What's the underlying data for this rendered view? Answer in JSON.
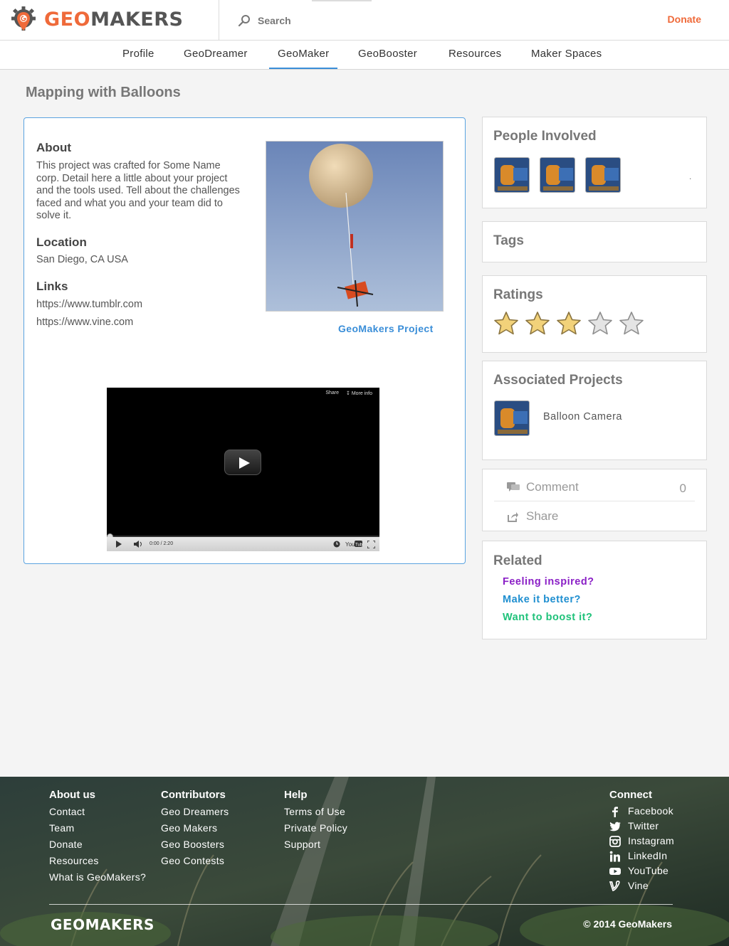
{
  "header": {
    "logo_geo": "GEO",
    "logo_makers": "MAKERS",
    "search_label": "Search",
    "donate_label": "Donate"
  },
  "nav": {
    "items": [
      {
        "label": "Profile"
      },
      {
        "label": "GeoDreamer"
      },
      {
        "label": "GeoMaker",
        "active": true
      },
      {
        "label": "GeoBooster"
      },
      {
        "label": "Resources"
      },
      {
        "label": "Maker Spaces"
      }
    ]
  },
  "page": {
    "title": "Mapping with Balloons"
  },
  "project": {
    "about_heading": "About",
    "about_lines": [
      "This project was crafted for Some Name",
      "corp. Detail here a little about your project",
      "and the tools used. Tell about the challenges",
      "faced and what you and your team did to",
      "solve it."
    ],
    "location_heading": "Location",
    "location_value": "San Diego, CA USA",
    "links_heading": "Links",
    "links": [
      "https://www.tumblr.com",
      "https://www.vine.com"
    ],
    "photo_caption": "GeoMakers Project",
    "video": {
      "share_label": "Share",
      "more_info_label": "More info",
      "time": "0:00 / 2:20",
      "progress": 0
    }
  },
  "sidebar": {
    "people_heading": "People Involved",
    "people_count": 3,
    "people_more": ".",
    "tags_heading": "Tags",
    "ratings_heading": "Ratings",
    "rating": 3,
    "rating_max": 5,
    "associated_heading": "Associated Projects",
    "associated_projects": [
      {
        "name": "Balloon Camera"
      }
    ],
    "comment_label": "Comment",
    "comment_count": "0",
    "share_label": "Share",
    "related_heading": "Related",
    "related_links": [
      {
        "label": "Feeling inspired?",
        "color": "#8a1fc6"
      },
      {
        "label": "Make it better?",
        "color": "#1f8fd0"
      },
      {
        "label": "Want to boost it?",
        "color": "#1fc27a"
      }
    ]
  },
  "footer": {
    "columns": [
      {
        "heading": "About us",
        "links": [
          "Contact",
          "Team",
          "Donate",
          "Resources",
          "What is GeoMakers?"
        ]
      },
      {
        "heading": "Contributors",
        "links": [
          "Geo Dreamers",
          "Geo Makers",
          "Geo Boosters",
          "Geo Contests"
        ]
      },
      {
        "heading": "Help",
        "links": [
          "Terms of Use",
          "Private Policy",
          "Support"
        ]
      }
    ],
    "connect_heading": "Connect",
    "social": [
      {
        "label": "Facebook",
        "icon": "facebook-icon"
      },
      {
        "label": "Twitter",
        "icon": "twitter-icon"
      },
      {
        "label": "Instagram",
        "icon": "instagram-icon"
      },
      {
        "label": "LinkedIn",
        "icon": "linkedin-icon"
      },
      {
        "label": "YouTube",
        "icon": "youtube-icon"
      },
      {
        "label": "Vine",
        "icon": "vine-icon"
      }
    ],
    "logo": "GEOMAKERS",
    "copyright": "© 2014 GeoMakers"
  },
  "colors": {
    "brand_orange": "#ef6a3a",
    "link_blue": "#3a8ed8",
    "card_border_active": "#5aa3e0"
  }
}
